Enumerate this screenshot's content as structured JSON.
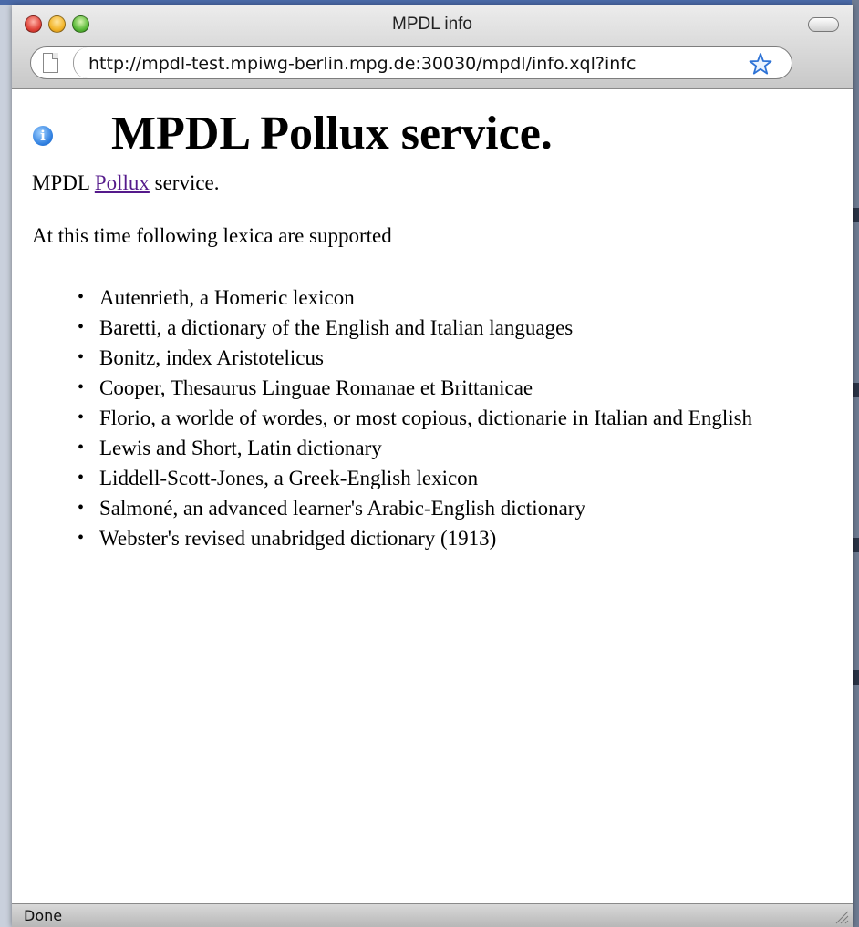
{
  "window": {
    "title": "MPDL info"
  },
  "address_bar": {
    "url": "http://mpdl-test.mpiwg-berlin.mpg.de:30030/mpdl/info.xql?infc"
  },
  "page": {
    "heading": "MPDL Pollux service.",
    "intro": {
      "before": "MPDL",
      "link": "Pollux",
      "after": "service."
    },
    "subheading": "At this time following lexica are supported",
    "lexica": [
      "Autenrieth, a Homeric lexicon",
      "Baretti, a dictionary of the English and Italian languages",
      "Bonitz, index Aristotelicus",
      "Cooper, Thesaurus Linguae Romanae et Brittanicae",
      "Florio, a worlde of wordes, or most copious, dictionarie in Italian and English",
      "Lewis and Short, Latin dictionary",
      "Liddell-Scott-Jones, a Greek-English lexicon",
      "Salmoné, an advanced learner's Arabic-English dictionary",
      "Webster's revised unabridged dictionary (1913)"
    ]
  },
  "status_bar": {
    "text": "Done"
  },
  "icons": {
    "traffic_lights": [
      "close-icon",
      "minimize-icon",
      "zoom-icon"
    ],
    "toolbar_toggle": "toolbar-toggle-icon",
    "page": "page-icon",
    "bookmark": "star-icon",
    "info": "info-icon",
    "resize": "resize-grip-icon"
  },
  "colors": {
    "visited_link": "#551a8b",
    "info_icon": "#2f7fe0"
  }
}
